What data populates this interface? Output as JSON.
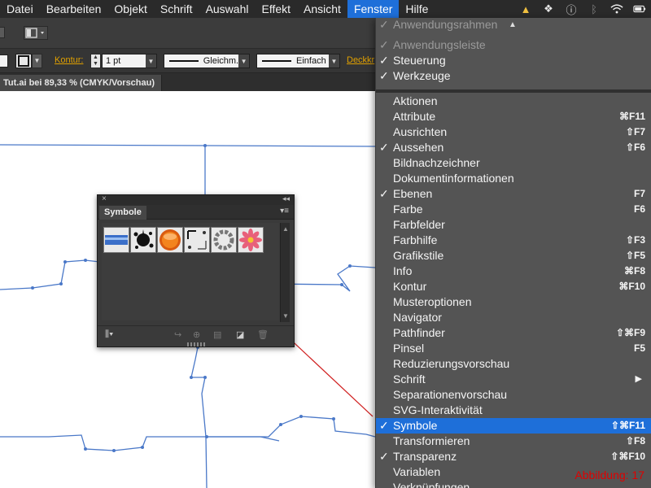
{
  "menubar": {
    "items": [
      "Datei",
      "Bearbeiten",
      "Objekt",
      "Schrift",
      "Auswahl",
      "Effekt",
      "Ansicht",
      "Fenster",
      "Hilfe"
    ],
    "active_item": "Fenster"
  },
  "toolbar": {
    "stroke_label": "Kontur:",
    "stroke_weight": "1 pt",
    "stroke_profile": "Gleichm.",
    "brush": "Einfach",
    "opacity_label": "Deckkr"
  },
  "document_tab": {
    "title": "Tut.ai bei 89,33 % (CMYK/Vorschau)"
  },
  "symbol_panel": {
    "tab_label": "Symbole",
    "symbols": [
      "blue-banner-symbol",
      "ink-splash-symbol",
      "orange-button-symbol",
      "frame-symbol",
      "ring-symbol",
      "flower-symbol"
    ]
  },
  "window_menu": {
    "top_items": [
      {
        "label": "Anwendungsrahmen",
        "checked": true,
        "disabled": true
      },
      {
        "label": "Anwendungsleiste",
        "checked": true,
        "disabled": true
      },
      {
        "label": "Steuerung",
        "checked": true,
        "disabled": false
      },
      {
        "label": "Werkzeuge",
        "checked": true,
        "disabled": false
      }
    ],
    "items": [
      {
        "label": "Aktionen",
        "checked": false,
        "shortcut": ""
      },
      {
        "label": "Attribute",
        "checked": false,
        "shortcut": "⌘F11"
      },
      {
        "label": "Ausrichten",
        "checked": false,
        "shortcut": "⇧F7"
      },
      {
        "label": "Aussehen",
        "checked": true,
        "shortcut": "⇧F6"
      },
      {
        "label": "Bildnachzeichner",
        "checked": false,
        "shortcut": ""
      },
      {
        "label": "Dokumentinformationen",
        "checked": false,
        "shortcut": ""
      },
      {
        "label": "Ebenen",
        "checked": true,
        "shortcut": "F7"
      },
      {
        "label": "Farbe",
        "checked": false,
        "shortcut": "F6"
      },
      {
        "label": "Farbfelder",
        "checked": false,
        "shortcut": ""
      },
      {
        "label": "Farbhilfe",
        "checked": false,
        "shortcut": "⇧F3"
      },
      {
        "label": "Grafikstile",
        "checked": false,
        "shortcut": "⇧F5"
      },
      {
        "label": "Info",
        "checked": false,
        "shortcut": "⌘F8"
      },
      {
        "label": "Kontur",
        "checked": false,
        "shortcut": "⌘F10"
      },
      {
        "label": "Musteroptionen",
        "checked": false,
        "shortcut": ""
      },
      {
        "label": "Navigator",
        "checked": false,
        "shortcut": ""
      },
      {
        "label": "Pathfinder",
        "checked": false,
        "shortcut": "⇧⌘F9"
      },
      {
        "label": "Pinsel",
        "checked": false,
        "shortcut": "F5"
      },
      {
        "label": "Reduzierungsvorschau",
        "checked": false,
        "shortcut": ""
      },
      {
        "label": "Schrift",
        "checked": false,
        "shortcut": "",
        "submenu": true
      },
      {
        "label": "Separationenvorschau",
        "checked": false,
        "shortcut": ""
      },
      {
        "label": "SVG-Interaktivität",
        "checked": false,
        "shortcut": ""
      },
      {
        "label": "Symbole",
        "checked": true,
        "shortcut": "⇧⌘F11",
        "highlighted": true
      },
      {
        "label": "Transformieren",
        "checked": false,
        "shortcut": "⇧F8"
      },
      {
        "label": "Transparenz",
        "checked": true,
        "shortcut": "⇧⌘F10"
      },
      {
        "label": "Variablen",
        "checked": false,
        "shortcut": ""
      },
      {
        "label": "Verknüpfungen",
        "checked": false,
        "shortcut": ""
      }
    ]
  },
  "caption": "Abbildung: 17",
  "colors": {
    "menu_highlight": "#1e6fd9",
    "puzzle_stroke": "#4a78c8",
    "arrow": "#d02020",
    "caption": "#e00000"
  }
}
